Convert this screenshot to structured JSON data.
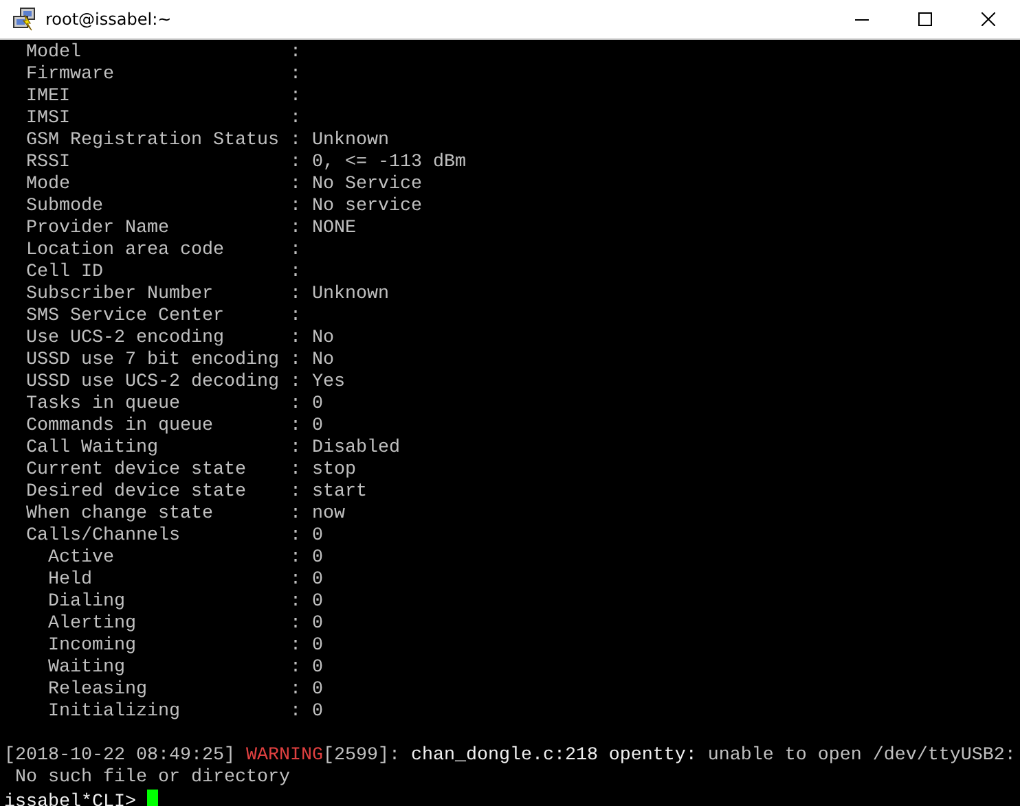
{
  "window": {
    "title": "root@issabel:~"
  },
  "status_rows": [
    {
      "label": "Model",
      "value": ":"
    },
    {
      "label": "Firmware",
      "value": ":"
    },
    {
      "label": "IMEI",
      "value": ":"
    },
    {
      "label": "IMSI",
      "value": ":"
    },
    {
      "label": "GSM Registration Status",
      "value": ": Unknown"
    },
    {
      "label": "RSSI",
      "value": ": 0, <= -113 dBm"
    },
    {
      "label": "Mode",
      "value": ": No Service"
    },
    {
      "label": "Submode",
      "value": ": No service"
    },
    {
      "label": "Provider Name",
      "value": ": NONE"
    },
    {
      "label": "Location area code",
      "value": ":"
    },
    {
      "label": "Cell ID",
      "value": ":"
    },
    {
      "label": "Subscriber Number",
      "value": ": Unknown"
    },
    {
      "label": "SMS Service Center",
      "value": ":"
    },
    {
      "label": "Use UCS-2 encoding",
      "value": ": No"
    },
    {
      "label": "USSD use 7 bit encoding",
      "value": ": No"
    },
    {
      "label": "USSD use UCS-2 decoding",
      "value": ": Yes"
    },
    {
      "label": "Tasks in queue",
      "value": ": 0"
    },
    {
      "label": "Commands in queue",
      "value": ": 0"
    },
    {
      "label": "Call Waiting",
      "value": ": Disabled"
    },
    {
      "label": "Current device state",
      "value": ": stop"
    },
    {
      "label": "Desired device state",
      "value": ": start"
    },
    {
      "label": "When change state",
      "value": ": now"
    },
    {
      "label": "Calls/Channels",
      "value": ": 0",
      "children": [
        {
          "label": "Active",
          "value": ": 0"
        },
        {
          "label": "Held",
          "value": ": 0"
        },
        {
          "label": "Dialing",
          "value": ": 0"
        },
        {
          "label": "Alerting",
          "value": ": 0"
        },
        {
          "label": "Incoming",
          "value": ": 0"
        },
        {
          "label": "Waiting",
          "value": ": 0"
        },
        {
          "label": "Releasing",
          "value": ": 0"
        },
        {
          "label": "Initializing",
          "value": ": 0"
        }
      ]
    }
  ],
  "log": {
    "timestamp": "[2018-10-22 08:49:25]",
    "level": "WARNING",
    "pid": "[2599]:",
    "source": "chan_dongle.c:218 opentty:",
    "message": "unable to open /dev/ttyUSB2:",
    "continuation": "No such file or directory"
  },
  "prompt": "issabel*CLI>"
}
